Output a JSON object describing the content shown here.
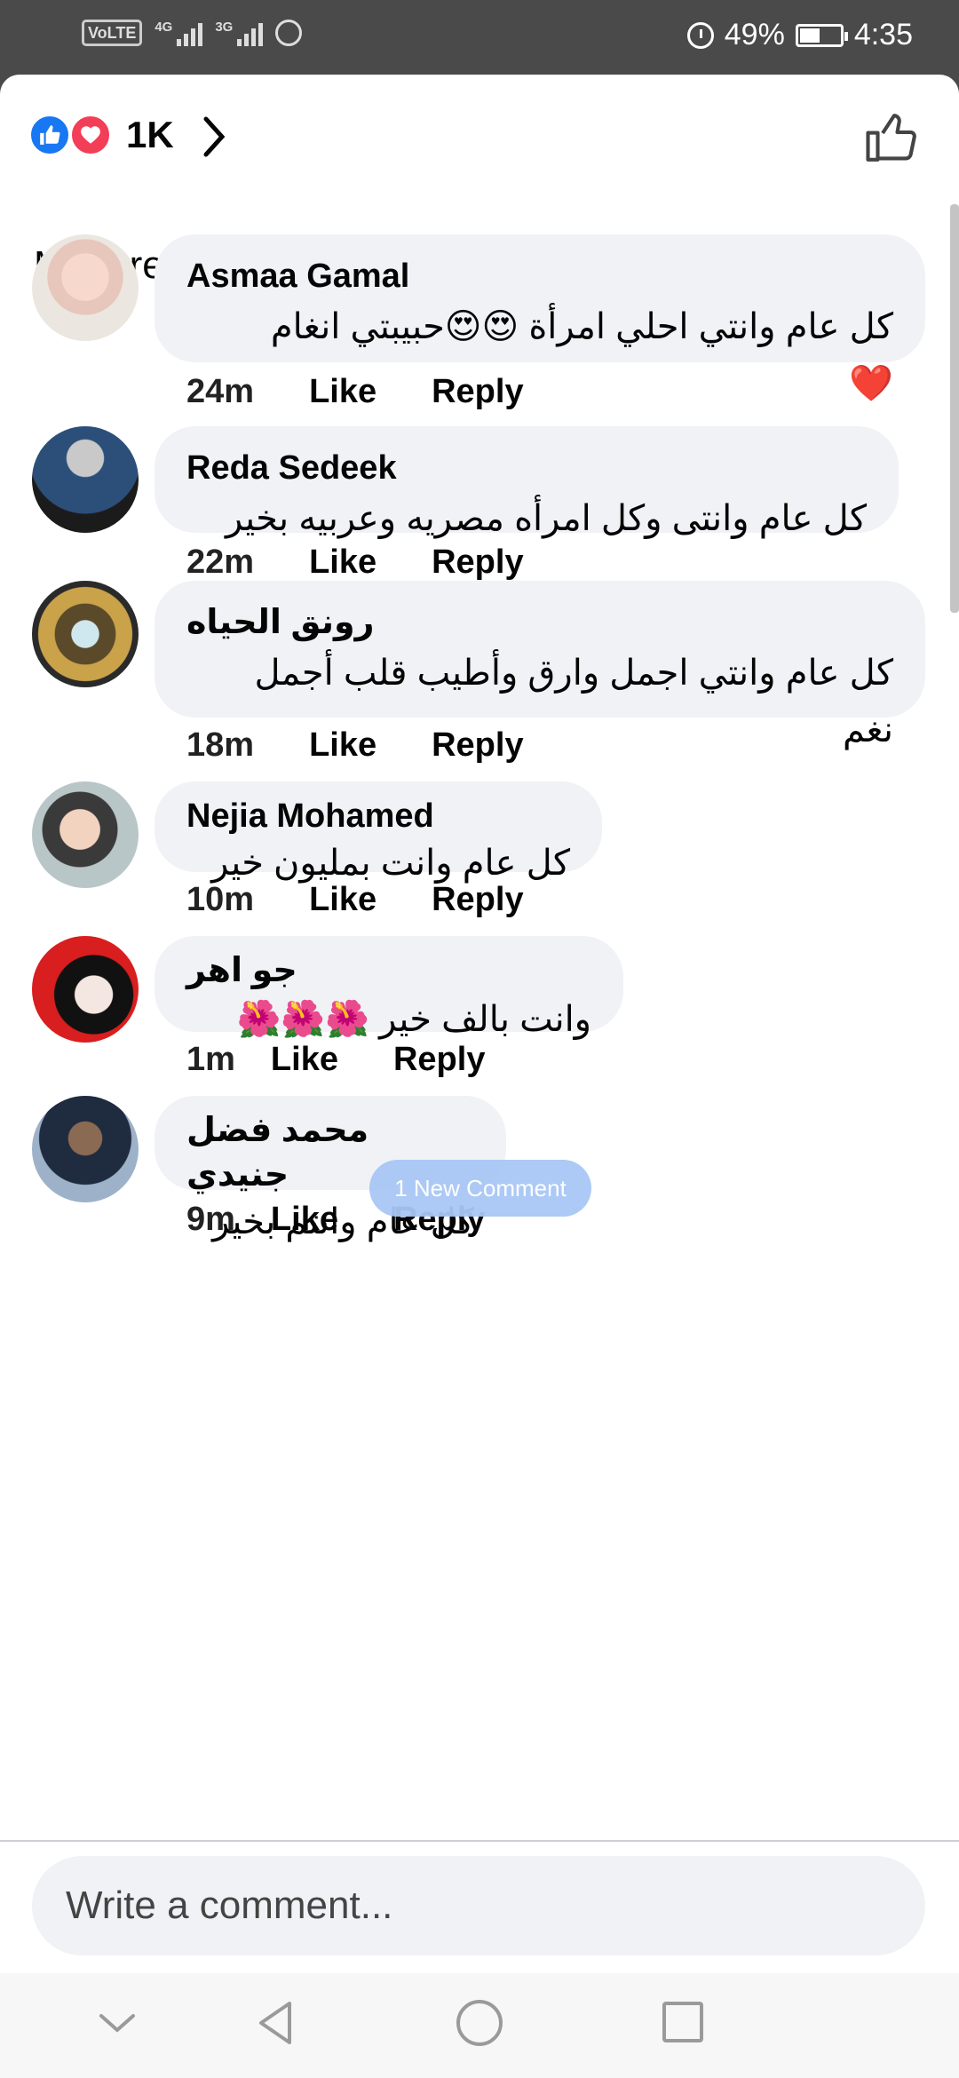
{
  "status_bar": {
    "volte": "VoLTE",
    "net1": "4G",
    "net2": "3G",
    "battery": "49%",
    "time": "4:35"
  },
  "header": {
    "reaction_count": "1K",
    "reactions": [
      "like-icon",
      "love-icon"
    ]
  },
  "sort": {
    "label": "Most relevant"
  },
  "comments": [
    {
      "author": "Asmaa Gamal",
      "text": "كل عام وانتي احلي امرأة 😍😍حبيبتي انغام",
      "text2": "❤️",
      "time": "24m",
      "like": "Like",
      "reply": "Reply"
    },
    {
      "author": "Reda Sedeek",
      "text": "كل عام وانتى وكل امرأه مصريه وعربيه بخير",
      "time": "22m",
      "like": "Like",
      "reply": "Reply"
    },
    {
      "author": "رونق الحياه",
      "text": "كل عام وانتي اجمل وارق وأطيب قلب أجمل",
      "text2": "نغم",
      "time": "18m",
      "like": "Like",
      "reply": "Reply"
    },
    {
      "author": "Nejia Mohamed",
      "text": "كل عام وانت بمليون خير",
      "time": "10m",
      "like": "Like",
      "reply": "Reply"
    },
    {
      "author": "جو اهر",
      "text": "وانت بالف خير 🌺🌺🌺",
      "time": "1m",
      "like": "Like",
      "reply": "Reply"
    },
    {
      "author": "محمد فضل جنيدي",
      "text": "كل عام وانتم بخير",
      "time": "9m",
      "like": "Like",
      "reply": "Reply"
    }
  ],
  "new_comment_pill": "1 New Comment",
  "composer": {
    "placeholder": "Write a comment..."
  },
  "colors": {
    "like_blue": "#1877f2",
    "love_red": "#f33e58",
    "bubble_bg": "#f0f2f5"
  }
}
